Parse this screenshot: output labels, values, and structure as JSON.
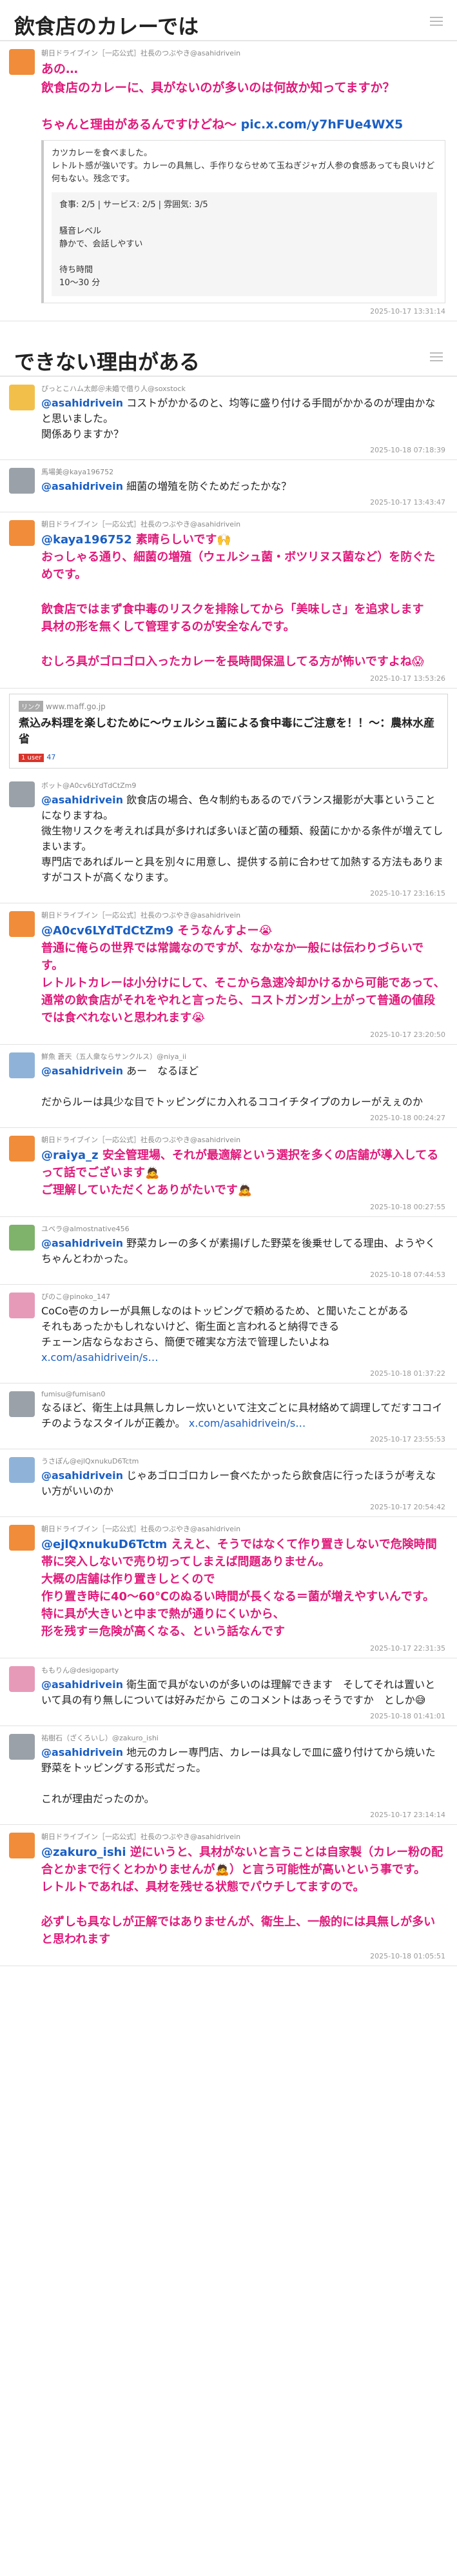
{
  "sections": {
    "first": "飲食店のカレーでは",
    "second": "できない理由がある"
  },
  "post1": {
    "author": "朝日ドライブイン［一応公式］社長のつぶやき@asahidrivein",
    "text": "あの…\n飲食店のカレーに、具がないのが多いのは何故か知ってますか？\n\nちゃんと理由があるんですけどね～ ",
    "link": "pic.x.com/y7hFUe4WX5",
    "quote": "カツカレーを食べました。\nレトルト感が強いです。カレーの具無し、手作りならせめて玉ねぎジャガ人参の食感あっても良いけど何もない。残念です。",
    "quote_inner": "食事: 2/5 | サービス: 2/5 | 雰囲気: 3/5\n\n騒音レベル\n静かで、会話しやすい\n\n待ち時間\n10～30 分",
    "time": "2025-10-17 13:31:14"
  },
  "posts": [
    {
      "author": "ぴっとこハム太郎＠未婚で借り人@soxstock",
      "mention": "@asahidrivein",
      "text": " コストがかかるのと、均等に盛り付ける手間がかかるのが理由かなと思いました。\n関係ありますか？",
      "time": "2025-10-18 07:18:39",
      "pink": false,
      "avatar": "yellow"
    },
    {
      "author": "馬場美@kaya196752",
      "mention": "@asahidrivein",
      "text": " 細菌の増殖を防ぐためだったかな？",
      "time": "2025-10-17 13:43:47",
      "pink": false,
      "avatar": "gray"
    },
    {
      "author": "朝日ドライブイン［一応公式］社長のつぶやき@asahidrivein",
      "mention": "@kaya196752",
      "text": " 素晴らしいです🙌\nおっしゃる通り、細菌の増殖（ウェルシュ菌・ボツリヌス菌など）を防ぐためです。\n\n飲食店ではまず食中毒のリスクを排除してから「美味しさ」を追求します\n具材の形を無くして管理するのが安全なんです。\n\nむしろ具がゴロゴロ入ったカレーを長時間保温してる方が怖いですよね😱",
      "time": "2025-10-17 13:53:26",
      "pink": true,
      "avatar": "orange"
    }
  ],
  "card": {
    "domain_tag": "リンク",
    "domain": "www.maff.go.jp",
    "title": "煮込み料理を楽しむために～ウェルシュ菌による食中毒にご注意を！！～：農林水産省",
    "users": "1 user",
    "count": "47"
  },
  "posts2": [
    {
      "author": "ボット@A0cv6LYdTdCtZm9",
      "mention": "@asahidrivein",
      "text": " 飲食店の場合、色々制約もあるのでバランス撮影が大事ということになりますね。\n微生物リスクを考えれば具が多ければ多いほど菌の種類、殺菌にかかる条件が増えてしまいます。\n専門店であればルーと具を別々に用意し、提供する前に合わせて加熱する方法もありますがコストが高くなります。",
      "time": "2025-10-17 23:16:15",
      "pink": false,
      "avatar": "gray"
    },
    {
      "author": "朝日ドライブイン［一応公式］社長のつぶやき@asahidrivein",
      "mention": "@A0cv6LYdTdCtZm9",
      "text": " そうなんすよー😭\n普通に俺らの世界では常識なのですが、なかなか一般には伝わりづらいです。\nレトルトカレーは小分けにして、そこから急速冷却かけるから可能であって、通常の飲食店がそれをやれと言ったら、コストガンガン上がって普通の値段では食べれないと思われます😭",
      "time": "2025-10-17 23:20:50",
      "pink": true,
      "avatar": "orange"
    },
    {
      "author": "鮮魚 蒼天（五人衆ならサンクルス）@niya_ii",
      "mention": "@asahidrivein",
      "text": " あー　なるほど\n\nだからルーは具少な目でトッピングにカ入れるココイチタイプのカレーがえぇのか",
      "time": "2025-10-18 00:24:27",
      "pink": false,
      "avatar": "blue"
    },
    {
      "author": "朝日ドライブイン［一応公式］社長のつぶやき@asahidrivein",
      "mention": "@raiya_z",
      "text": " 安全管理場、それが最適解という選択を多くの店舗が導入してるって話でございます🙇\nご理解していただくとありがたいです🙇",
      "time": "2025-10-18 00:27:55",
      "pink": true,
      "avatar": "orange"
    },
    {
      "author": "ユベラ@almostnative456",
      "mention": "@asahidrivein",
      "text": " 野菜カレーの多くが素揚げした野菜を後乗せしてる理由、ようやくちゃんとわかった。",
      "time": "2025-10-18 07:44:53",
      "pink": false,
      "avatar": "green"
    },
    {
      "author": "ぴのこ@pinoko_147",
      "mention": "",
      "text": "CoCo壱のカレーが具無しなのはトッピングで頼めるため、と聞いたことがある\nそれもあったかもしれないけど、衛生面と言われると納得できる\nチェーン店ならなおさら、簡便で確実な方法で管理したいよね\n",
      "link": "x.com/asahidrivein/s…",
      "time": "2025-10-18 01:37:22",
      "pink": false,
      "avatar": "pink"
    },
    {
      "author": "fumisu@fumisan0",
      "mention": "",
      "text": "なるほど、衛生上は具無しカレー炊いといて注文ごとに具材絡めて調理してだすココイチのようなスタイルが正義か。 ",
      "link": "x.com/asahidrivein/s…",
      "time": "2025-10-17 23:55:53",
      "pink": false,
      "avatar": "gray"
    },
    {
      "author": "うさぽん@ejlQxnukuD6Tctm",
      "mention": "@asahidrivein",
      "text": " じゃあゴロゴロカレー食べたかったら飲食店に行ったほうが考えない方がいいのか",
      "time": "2025-10-17 20:54:42",
      "pink": false,
      "avatar": "blue"
    },
    {
      "author": "朝日ドライブイン［一応公式］社長のつぶやき@asahidrivein",
      "mention": "@ejlQxnukuD6Tctm",
      "text": " ええと、そうではなくて作り置きしないで危険時間帯に突入しないで売り切ってしまえば問題ありません。\n大概の店舗は作り置きしとくので\n作り置き時に40～60℃のぬるい時間が長くなる＝菌が増えやすいんです。\n特に具が大きいと中まで熱が通りにくいから、\n形を残す＝危険が高くなる、という話なんです",
      "time": "2025-10-17 22:31:35",
      "pink": true,
      "avatar": "orange"
    },
    {
      "author": "ももりん@desigoparty",
      "mention": "@asahidrivein",
      "text": " 衛生面で具がないのが多いのは理解できます　そしてそれは置いといて具の有り無しについては好みだから このコメントはあっそうですか　としか😅",
      "time": "2025-10-18 01:41:01",
      "pink": false,
      "avatar": "pink"
    },
    {
      "author": "祐樹石（ざくろいし）@zakuro_ishi",
      "mention": "@asahidrivein",
      "text": " 地元のカレー専門店、カレーは具なしで皿に盛り付けてから焼いた野菜をトッピングする形式だった。\n\nこれが理由だったのか。",
      "time": "2025-10-17 23:14:14",
      "pink": false,
      "avatar": "gray"
    },
    {
      "author": "朝日ドライブイン［一応公式］社長のつぶやき@asahidrivein",
      "mention": "@zakuro_ishi",
      "text": " 逆にいうと、具材がないと言うことは自家製（カレー粉の配合とかまで行くとわかりませんが🙇）と言う可能性が高いという事です。\nレトルトであれば、具材を残せる状態でパウチしてますので。\n\n必ずしも具なしが正解ではありませんが、衛生上、一般的には具無しが多いと思われます",
      "time": "2025-10-18 01:05:51",
      "pink": true,
      "avatar": "orange"
    }
  ]
}
